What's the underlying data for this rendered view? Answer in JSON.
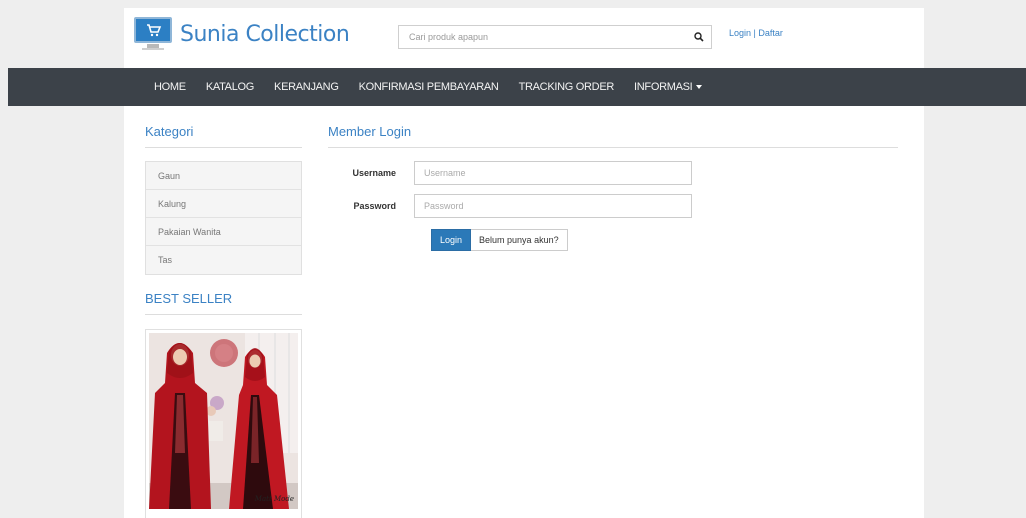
{
  "header": {
    "brand": "Sunia Collection",
    "search_placeholder": "Cari produk apapun",
    "login_label": "Login",
    "separator": "|",
    "register_label": "Daftar"
  },
  "nav": {
    "items": [
      "HOME",
      "KATALOG",
      "KERANJANG",
      "KONFIRMASI PEMBAYARAN",
      "TRACKING ORDER",
      "INFORMASI"
    ]
  },
  "sidebar": {
    "category_title": "Kategori",
    "categories": [
      "Gaun",
      "Kalung",
      "Pakaian Wanita",
      "Tas"
    ],
    "best_seller_title": "BEST SELLER",
    "product_watermark": "Matt Mode"
  },
  "main": {
    "title": "Member Login",
    "username_label": "Username",
    "username_placeholder": "Username",
    "password_label": "Password",
    "password_placeholder": "Password",
    "login_button": "Login",
    "register_button": "Belum punya akun?"
  },
  "colors": {
    "brand_blue": "#3b82c4",
    "navbar": "#3c4249",
    "primary_button": "#2b79b8"
  }
}
